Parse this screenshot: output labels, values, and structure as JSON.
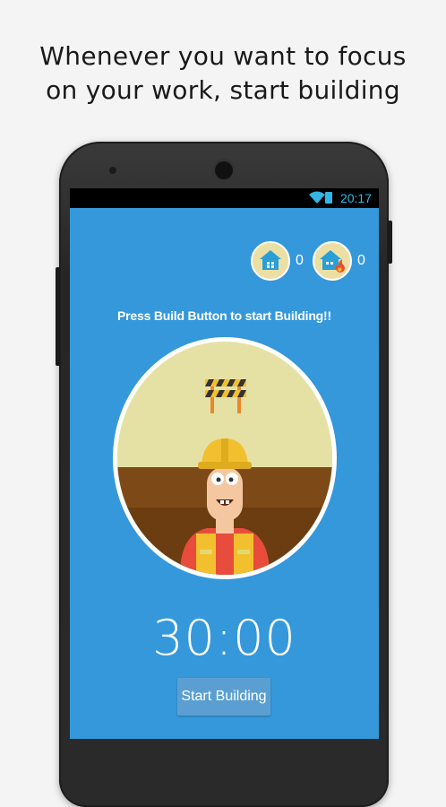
{
  "headline": {
    "line1": "Whenever you want to focus",
    "line2": "on your work, start building"
  },
  "status_bar": {
    "time": "20:17",
    "icons": [
      "wifi-icon",
      "battery-charging-icon"
    ]
  },
  "counters": {
    "built": {
      "icon": "house-icon",
      "value": "0"
    },
    "burnt": {
      "icon": "house-fire-icon",
      "value": "0"
    }
  },
  "prompt": "Press Build Button to start Building!!",
  "timer": "30:00",
  "start_button": {
    "label": "Start Building"
  },
  "colors": {
    "screen_bg": "#3498db",
    "badge_bg": "#ecdfa4",
    "button_bg": "#5b9fd2",
    "helmet": "#f2c02f",
    "sky": "#e5e1a5",
    "ground": "#7d4a17"
  }
}
